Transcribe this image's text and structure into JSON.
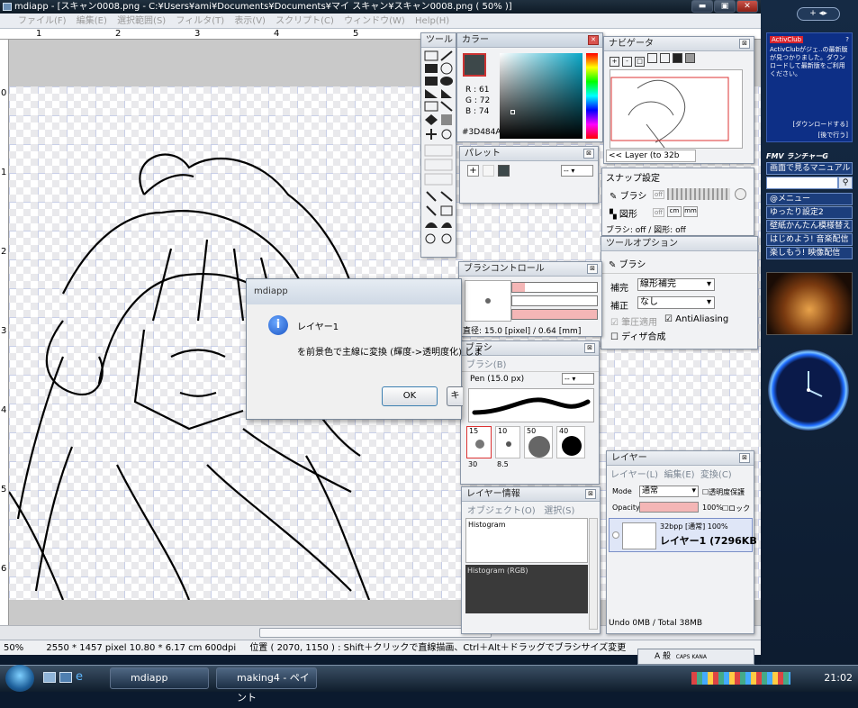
{
  "window": {
    "title": "mdiapp - [スキャン0008.png - C:¥Users¥ami¥Documents¥Documents¥マイ スキャン¥スキャン0008.png ( 50% )]",
    "min": "▬",
    "max": "▣",
    "close": "✕"
  },
  "menu": [
    "ファイル(F)",
    "編集(E)",
    "選択範囲(S)",
    "フィルタ(T)",
    "表示(V)",
    "スクリプト(C)",
    "ウィンドウ(W)",
    "Help(H)"
  ],
  "ruler": {
    "h": [
      "1",
      "2",
      "3",
      "4",
      "5"
    ],
    "v": [
      "0",
      "1",
      "2",
      "3",
      "4",
      "5",
      "6"
    ]
  },
  "tools_panel": {
    "title": "ツール"
  },
  "color_panel": {
    "title": "カラー",
    "r": "R : 61",
    "g": "G : 72",
    "b": "B : 74",
    "hex": "#3D484A",
    "current": "#3D484A"
  },
  "navigator": {
    "title": "ナビゲータ",
    "layer_btn": "<< Layer (to 32b"
  },
  "palette": {
    "title": "パレット",
    "add": "+",
    "menu": "--"
  },
  "snap": {
    "title": "スナップ設定",
    "brush": "ブラシ",
    "shape": "図形",
    "off": "off",
    "cm": "cm",
    "mm": "mm",
    "status": "ブラシ: off / 図形: off"
  },
  "tool_options": {
    "title": "ツールオプション",
    "tool_name": "ブラシ",
    "interp_label": "補完",
    "interp_value": "線形補完",
    "correct_label": "補正",
    "correct_value": "なし",
    "pressure": "筆圧適用",
    "antialias": "AntiAliasing",
    "dither": "ディザ合成"
  },
  "brush_control": {
    "title": "ブラシコントロール",
    "diameter": "直径: 15.0 [pixel] / 0.64 [mm]"
  },
  "brush": {
    "title": "ブラシ",
    "tab": "ブラシ(B)",
    "name": "Pen (15.0 px)",
    "menu": "--",
    "sizes": [
      "15",
      "10",
      "50",
      "40"
    ],
    "sizes2": [
      "30",
      "8.5"
    ]
  },
  "layer_info": {
    "title": "レイヤー情報",
    "menu_object": "オブジェクト(O)",
    "menu_select": "選択(S)",
    "hist": "Histogram",
    "hist_rgb": "Histogram (RGB)"
  },
  "layers": {
    "title": "レイヤー",
    "menu_layer": "レイヤー(L)",
    "menu_edit": "編集(E)",
    "menu_convert": "変換(C)",
    "mode_label": "Mode",
    "mode_value": "通常",
    "protect": "透明度保護",
    "opacity_label": "Opacity",
    "opacity_value": "100%",
    "opacity": 1.0,
    "lock": "ロック",
    "layer_meta": "32bpp [通常] 100%",
    "layer_name": "レイヤー1 (7296KB",
    "footer": "Undo 0MB / Total 38MB"
  },
  "dialog": {
    "title": "mdiapp",
    "heading": "レイヤー1",
    "message": "を前景色で主線に変換 (輝度->透明度化) しま",
    "ok": "OK",
    "other": "キ"
  },
  "status": {
    "zoom": "50%",
    "size": "2550 * 1457 pixel  10.80 * 6.17 cm   600dpi",
    "position": "位置 ( 2070, 1150 ) : Shift＋クリックで直線描画、Ctrl＋Alt＋ドラッグでブラシサイズ変更"
  },
  "sidebar": {
    "actclub": "ActivClub",
    "notice": "ActivClubがジェ..の最新版が見つかりました。ダウンロードして最新版をご利用ください。",
    "download": "[ダウンロードする]",
    "later": "[後で行う]",
    "launcher": "FMV ランチャーG",
    "items": [
      "画面で見るマニュアル",
      "@メニュー",
      "ゆったり設定2",
      "壁紙かんたん模様替え",
      "はじめよう! 音楽配信",
      "楽しもう! 映像配信"
    ]
  },
  "taskbar": {
    "tasks": [
      "mdiapp",
      "making4 - ペイント"
    ],
    "time": "21:02",
    "ime": "A 般",
    "caps": "CAPS KANA"
  }
}
